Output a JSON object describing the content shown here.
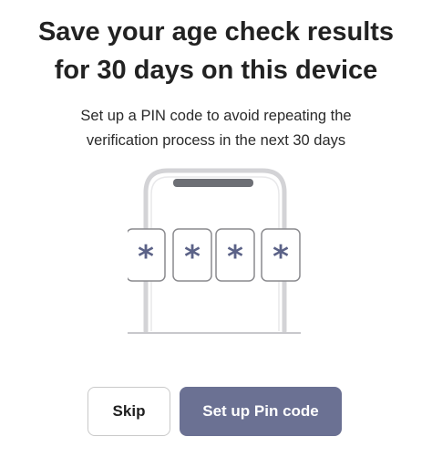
{
  "header": {
    "title_line1": "Save your age check results",
    "title_line2": "for 30 days on this device"
  },
  "body": {
    "subtitle_line1": "Set up a PIN code to avoid repeating the",
    "subtitle_line2": "verification process in the next 30 days"
  },
  "illustration": {
    "pin_digits": [
      "*",
      "*",
      "*",
      "*"
    ],
    "icon": "phone-with-pin-icon"
  },
  "actions": {
    "skip_label": "Skip",
    "setup_label": "Set up Pin code"
  },
  "colors": {
    "primary_button": "#6b7193",
    "phone_outline": "#d3d3d6",
    "phone_notch": "#6d6f75",
    "pin_asterisk": "#5b6287",
    "title_text": "#222222"
  }
}
